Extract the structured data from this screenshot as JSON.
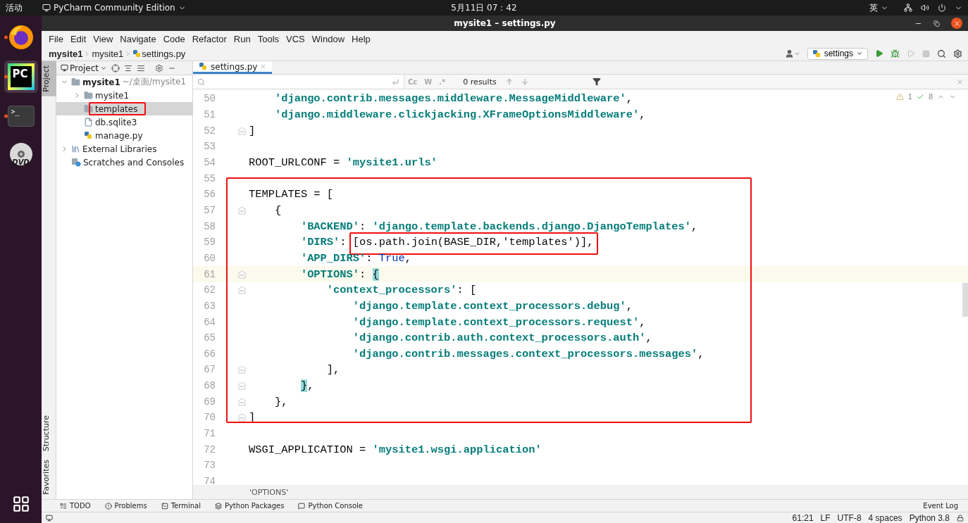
{
  "top_bar": {
    "activities": "活动",
    "app_menu": "PyCharm Community Edition",
    "clock": "5月11日  07：42",
    "input_method": "英"
  },
  "dock": [
    {
      "kind": "browser",
      "running": true,
      "selected": false
    },
    {
      "kind": "ide",
      "label": "PC",
      "running": true,
      "selected": true
    },
    {
      "kind": "terminal",
      "label": ">_",
      "running": true,
      "selected": false
    },
    {
      "kind": "disc",
      "label": "DVD",
      "running": false,
      "selected": false
    }
  ],
  "window": {
    "title": "mysite1 – settings.py"
  },
  "menu": [
    "File",
    "Edit",
    "View",
    "Navigate",
    "Code",
    "Refactor",
    "Run",
    "Tools",
    "VCS",
    "Window",
    "Help"
  ],
  "breadcrumb": [
    {
      "label": "mysite1",
      "bold": true
    },
    {
      "label": "mysite1",
      "bold": false
    },
    {
      "label": "settings.py",
      "bold": false,
      "kind": "python"
    }
  ],
  "run_config": "settings",
  "side_tabs": [
    {
      "label": "Project",
      "selected": true
    },
    {
      "label": "Structure",
      "selected": false
    },
    {
      "label": "Favorites",
      "selected": false
    }
  ],
  "project": {
    "title": "Project",
    "tree": [
      {
        "label": "mysite1",
        "hint": "~/桌面/mysite1",
        "kind": "folder",
        "bold": true,
        "expanded": true,
        "selected": false,
        "outlined": false,
        "children": [
          {
            "label": "mysite1",
            "kind": "folder",
            "bold": false,
            "expanded": false,
            "selected": false,
            "outlined": false
          },
          {
            "label": "templates",
            "kind": "folder",
            "bold": false,
            "selected": true,
            "outlined": true
          },
          {
            "label": "db.sqlite3",
            "kind": "file",
            "bold": false,
            "selected": false,
            "outlined": false
          },
          {
            "label": "manage.py",
            "kind": "python",
            "bold": false,
            "selected": false,
            "outlined": false
          }
        ]
      },
      {
        "label": "External Libraries",
        "kind": "library",
        "bold": false,
        "expanded": false,
        "selected": false,
        "outlined": false
      },
      {
        "label": "Scratches and Consoles",
        "kind": "scratch",
        "bold": false,
        "selected": false,
        "outlined": false
      }
    ]
  },
  "editor": {
    "tabs": [
      {
        "label": "settings.py",
        "selected": true
      }
    ],
    "find": {
      "options": [
        "Cc",
        "W",
        ".*"
      ],
      "results": "0 results"
    },
    "inspections": {
      "warnings": "1",
      "typos": "8"
    },
    "blocks": [
      {
        "outlined": false,
        "lines": [
          {
            "number": "50",
            "fold": false,
            "current": false,
            "tokens": [
              {
                "text": "    'django.contrib.messages.middleware.MessageMiddleware'",
                "kind": "string"
              },
              {
                "text": ",",
                "kind": "plain"
              }
            ]
          },
          {
            "number": "51",
            "fold": false,
            "current": false,
            "tokens": [
              {
                "text": "    'django.middleware.clickjacking.XFrameOptionsMiddleware'",
                "kind": "string"
              },
              {
                "text": ",",
                "kind": "plain"
              }
            ]
          },
          {
            "number": "52",
            "fold": true,
            "current": false,
            "tokens": [
              {
                "text": "]",
                "kind": "plain"
              }
            ]
          },
          {
            "number": "53",
            "fold": false,
            "current": false
          },
          {
            "number": "54",
            "fold": false,
            "current": false,
            "tokens": [
              {
                "text": "ROOT_URLCONF = ",
                "kind": "plain"
              },
              {
                "text": "'mysite1.urls'",
                "kind": "string"
              }
            ]
          },
          {
            "number": "55",
            "fold": false,
            "current": false
          }
        ]
      },
      {
        "outlined": true,
        "lines": [
          {
            "number": "56",
            "fold": false,
            "current": false,
            "tokens": [
              {
                "text": "TEMPLATES = [",
                "kind": "plain"
              }
            ]
          },
          {
            "number": "57",
            "fold": true,
            "current": false,
            "tokens": [
              {
                "text": "    {",
                "kind": "plain"
              }
            ]
          },
          {
            "number": "58",
            "fold": false,
            "current": false,
            "tokens": [
              {
                "text": "        'BACKEND'",
                "kind": "string"
              },
              {
                "text": ": ",
                "kind": "plain"
              },
              {
                "text": "'django.template.backends.django.DjangoTemplates'",
                "kind": "string"
              },
              {
                "text": ",",
                "kind": "plain"
              }
            ]
          },
          {
            "number": "59",
            "fold": false,
            "current": false,
            "tokens": [
              {
                "text": "        'DIRS'",
                "kind": "string",
                "outlined": false
              },
              {
                "text": ": ",
                "kind": "plain",
                "outlined": false
              },
              {
                "text": "[os.path.join(BASE_DIR,'templates')],",
                "kind": "plain",
                "outlined": true
              }
            ]
          },
          {
            "number": "60",
            "fold": false,
            "current": false,
            "tokens": [
              {
                "text": "        'APP_DIRS'",
                "kind": "string"
              },
              {
                "text": ": ",
                "kind": "plain"
              },
              {
                "text": "True",
                "kind": "keyword"
              },
              {
                "text": ",",
                "kind": "plain"
              }
            ]
          },
          {
            "number": "61",
            "fold": true,
            "current": true,
            "tokens": [
              {
                "text": "        'OPTIONS'",
                "kind": "string"
              },
              {
                "text": ": ",
                "kind": "plain"
              },
              {
                "text": "{",
                "kind": "brace_match"
              }
            ]
          },
          {
            "number": "62",
            "fold": true,
            "current": false,
            "tokens": [
              {
                "text": "            'context_processors'",
                "kind": "string"
              },
              {
                "text": ": [",
                "kind": "plain"
              }
            ]
          },
          {
            "number": "63",
            "fold": false,
            "current": false,
            "tokens": [
              {
                "text": "                'django.template.context_processors.debug'",
                "kind": "string"
              },
              {
                "text": ",",
                "kind": "plain"
              }
            ]
          },
          {
            "number": "64",
            "fold": false,
            "current": false,
            "tokens": [
              {
                "text": "                'django.template.context_processors.request'",
                "kind": "string"
              },
              {
                "text": ",",
                "kind": "plain"
              }
            ]
          },
          {
            "number": "65",
            "fold": false,
            "current": false,
            "tokens": [
              {
                "text": "                'django.contrib.auth.context_processors.auth'",
                "kind": "string"
              },
              {
                "text": ",",
                "kind": "plain"
              }
            ]
          },
          {
            "number": "66",
            "fold": false,
            "current": false,
            "tokens": [
              {
                "text": "                'django.contrib.messages.context_processors.messages'",
                "kind": "string"
              },
              {
                "text": ",",
                "kind": "plain"
              }
            ]
          },
          {
            "number": "67",
            "fold": true,
            "current": false,
            "tokens": [
              {
                "text": "            ],",
                "kind": "plain"
              }
            ]
          },
          {
            "number": "68",
            "fold": true,
            "current": false,
            "tokens": [
              {
                "text": "        }",
                "kind": "brace_match"
              },
              {
                "text": ",",
                "kind": "plain"
              }
            ]
          },
          {
            "number": "69",
            "fold": true,
            "current": false,
            "tokens": [
              {
                "text": "    },",
                "kind": "plain"
              }
            ]
          },
          {
            "number": "70",
            "fold": true,
            "current": false,
            "tokens": [
              {
                "text": "]",
                "kind": "plain"
              }
            ]
          }
        ]
      },
      {
        "outlined": false,
        "lines": [
          {
            "number": "71",
            "fold": false,
            "current": false
          },
          {
            "number": "72",
            "fold": false,
            "current": false,
            "tokens": [
              {
                "text": "WSGI_APPLICATION = ",
                "kind": "plain"
              },
              {
                "text": "'mysite1.wsgi.application'",
                "kind": "string"
              }
            ]
          },
          {
            "number": "73",
            "fold": false,
            "current": false
          },
          {
            "number": "74",
            "fold": false,
            "current": false
          }
        ]
      }
    ],
    "breadcrumb": "'OPTIONS'"
  },
  "tool_windows": [
    "TODO",
    "Problems",
    "Terminal",
    "Python Packages",
    "Python Console"
  ],
  "event_log": "Event Log",
  "status_bar": [
    "61:21",
    "LF",
    "UTF-8",
    "4 spaces",
    "Python 3.8"
  ]
}
